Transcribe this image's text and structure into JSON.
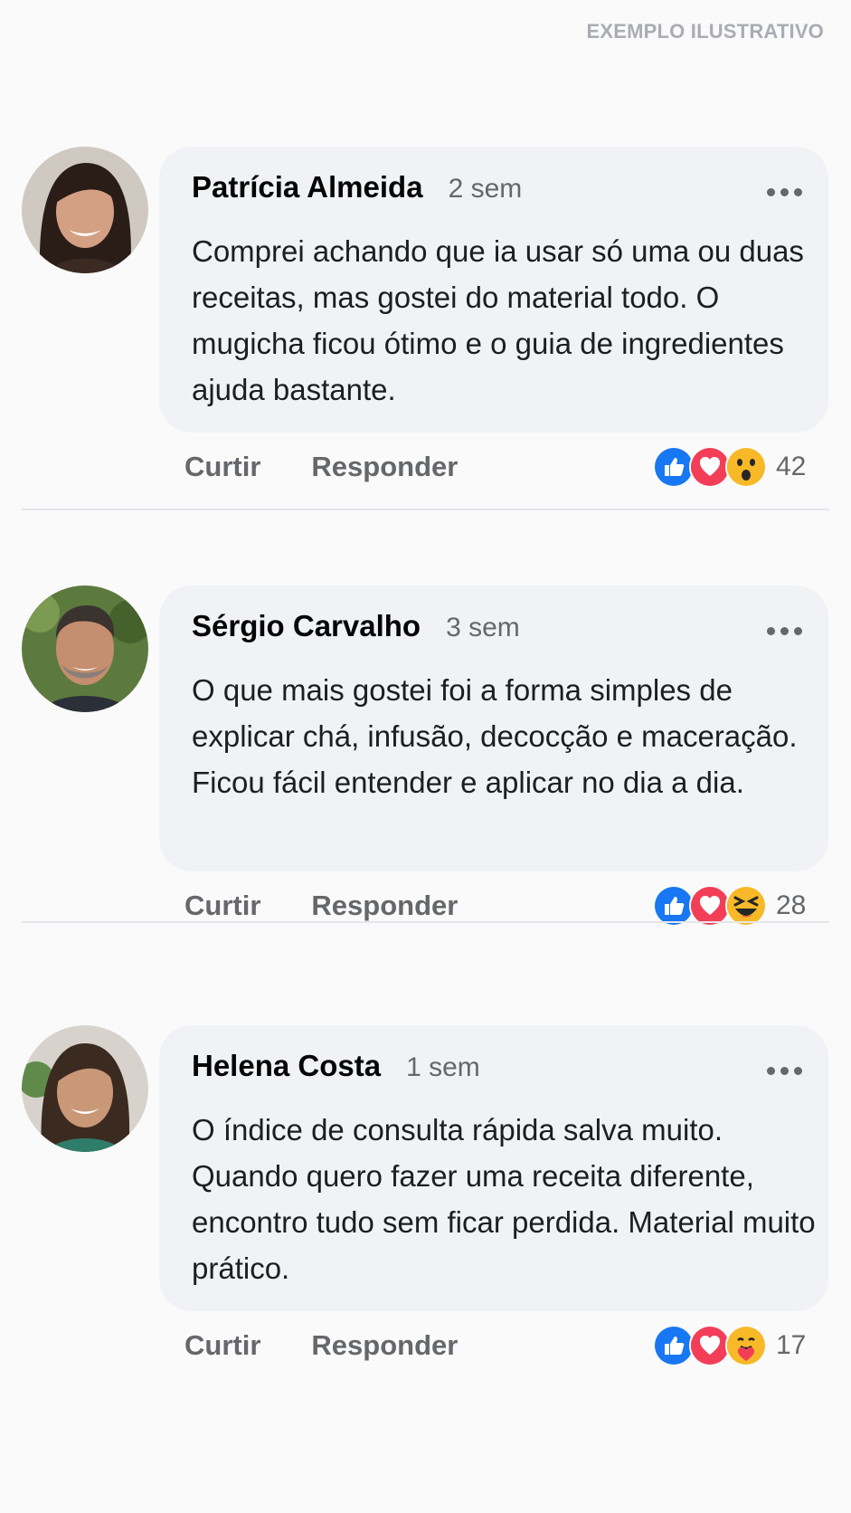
{
  "watermark": "EXEMPLO ILUSTRATIVO",
  "comments": [
    {
      "author": "Patrícia Almeida",
      "time": "2 sem",
      "text": "Comprei achando que ia usar só uma ou duas receitas, mas gostei do material todo. O mugicha ficou ótimo e o guia de ingredientes ajuda bastante.",
      "like_label": "Curtir",
      "reply_label": "Responder",
      "reactions": [
        "like-icon",
        "love-icon",
        "wow-icon"
      ],
      "reaction_count": "42"
    },
    {
      "author": "Sérgio Carvalho",
      "time": "3 sem",
      "text": "O que mais gostei foi a forma simples de explicar chá, infusão, decocção e maceração. Ficou fácil entender e aplicar no dia a dia.",
      "like_label": "Curtir",
      "reply_label": "Responder",
      "reactions": [
        "like-icon",
        "love-icon",
        "haha-icon"
      ],
      "reaction_count": "28"
    },
    {
      "author": "Helena Costa",
      "time": "1 sem",
      "text": "O índice de consulta rápida salva muito. Quando quero fazer uma receita diferente, encontro tudo sem ficar perdida. Material muito prático.",
      "like_label": "Curtir",
      "reply_label": "Responder",
      "reactions": [
        "like-icon",
        "love-icon",
        "care-icon"
      ],
      "reaction_count": "17"
    }
  ],
  "colors": {
    "like": "#1877f2",
    "love": "#f33e58",
    "yellow": "#f7b928",
    "bubble": "#f0f2f5",
    "secondary_text": "#65676b"
  }
}
